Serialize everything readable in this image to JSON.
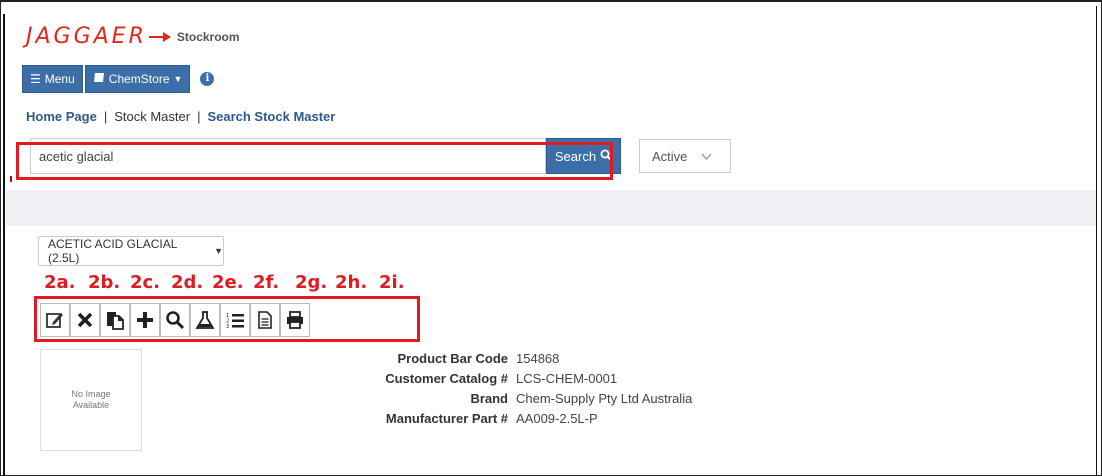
{
  "header": {
    "logo_text": "JAGGAER",
    "app_name": "Stockroom"
  },
  "nav": {
    "menu_label": "Menu",
    "store_label": "ChemStore"
  },
  "breadcrumb": {
    "home": "Home Page",
    "stock_master": "Stock Master",
    "search_stock_master": "Search Stock Master"
  },
  "search": {
    "value": "acetic glacial",
    "button_label": "Search",
    "status": "Active"
  },
  "product": {
    "selector_label": "ACETIC ACID GLACIAL (2.5L)",
    "image_placeholder": "No Image Available",
    "details": [
      {
        "label": "Product Bar Code",
        "value": "154868"
      },
      {
        "label": "Customer Catalog #",
        "value": "LCS-CHEM-0001"
      },
      {
        "label": "Brand",
        "value": "Chem-Supply Pty Ltd Australia"
      },
      {
        "label": "Manufacturer Part #",
        "value": "AA009-2.5L-P"
      }
    ]
  },
  "steps": [
    "2a.",
    "2b.",
    "2c.",
    "2d.",
    "2e.",
    "2f.",
    "2g.",
    "2h.",
    "2i."
  ],
  "toolbar_icons": [
    "edit-icon",
    "delete-icon",
    "copy-icon",
    "add-icon",
    "search-icon",
    "flask-icon",
    "ordered-list-icon",
    "document-icon",
    "print-icon"
  ],
  "colors": {
    "brand_red": "#e1261c",
    "primary_blue": "#3c6fa8",
    "annotation_red": "#e01b24",
    "link_blue": "#2c5a8c"
  }
}
